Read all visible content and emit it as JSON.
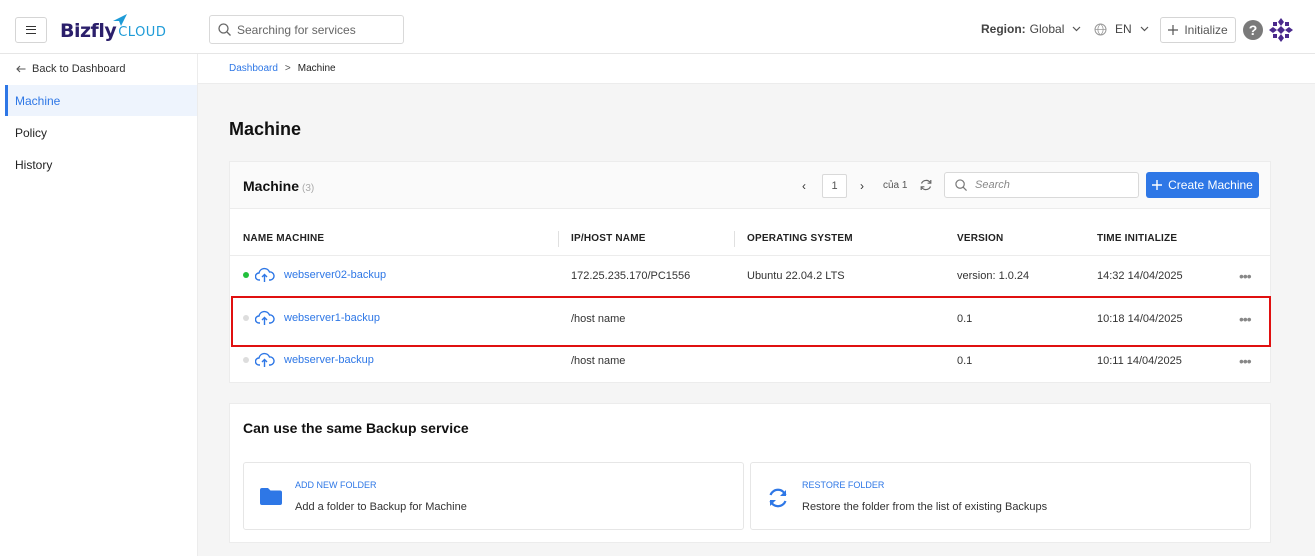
{
  "header": {
    "logo_text": "Bizfly",
    "logo_suffix": "CLOUD",
    "search_placeholder": "Searching for services",
    "region_label": "Region:",
    "region_value": "Global",
    "language": "EN",
    "initialize_label": "Initialize",
    "help_label": "?"
  },
  "sidebar": {
    "back_label": "Back to Dashboard",
    "items": [
      {
        "label": "Machine",
        "active": true
      },
      {
        "label": "Policy",
        "active": false
      },
      {
        "label": "History",
        "active": false
      }
    ]
  },
  "breadcrumb": {
    "root": "Dashboard",
    "separator": ">",
    "current": "Machine"
  },
  "page_title": "Machine",
  "machine_card": {
    "title": "Machine",
    "count": "(3)",
    "pager": {
      "prev": "‹",
      "page": "1",
      "next": "›",
      "of_label": "của 1"
    },
    "search_placeholder": "Search",
    "create_label": "Create Machine",
    "columns": [
      "NAME MACHINE",
      "IP/HOST NAME",
      "OPERATING SYSTEM",
      "VERSION",
      "TIME INITIALIZE"
    ],
    "rows": [
      {
        "name": "webserver02-backup",
        "host": "172.25.235.170/PC1556",
        "os": "Ubuntu 22.04.2 LTS",
        "version": "version: 1.0.24",
        "time": "14:32 14/04/2025",
        "online": true
      },
      {
        "name": "webserver1-backup",
        "host": "/host name",
        "os": "",
        "version": "0.1",
        "time": "10:18 14/04/2025",
        "online": false
      },
      {
        "name": "webserver-backup",
        "host": "/host name",
        "os": "",
        "version": "0.1",
        "time": "10:11 14/04/2025",
        "online": false
      }
    ],
    "more_label": "•••"
  },
  "backup_card": {
    "title": "Can use the same Backup service",
    "options": [
      {
        "title": "ADD NEW FOLDER",
        "desc": "Add a folder to Backup for Machine",
        "icon": "folder-icon"
      },
      {
        "title": "RESTORE FOLDER",
        "desc": "Restore the folder from the list of existing Backups",
        "icon": "restore-icon"
      }
    ]
  },
  "colors": {
    "accent": "#2e77e6",
    "online": "#22c03c",
    "offline": "#dddddd",
    "highlight": "#e01010"
  }
}
